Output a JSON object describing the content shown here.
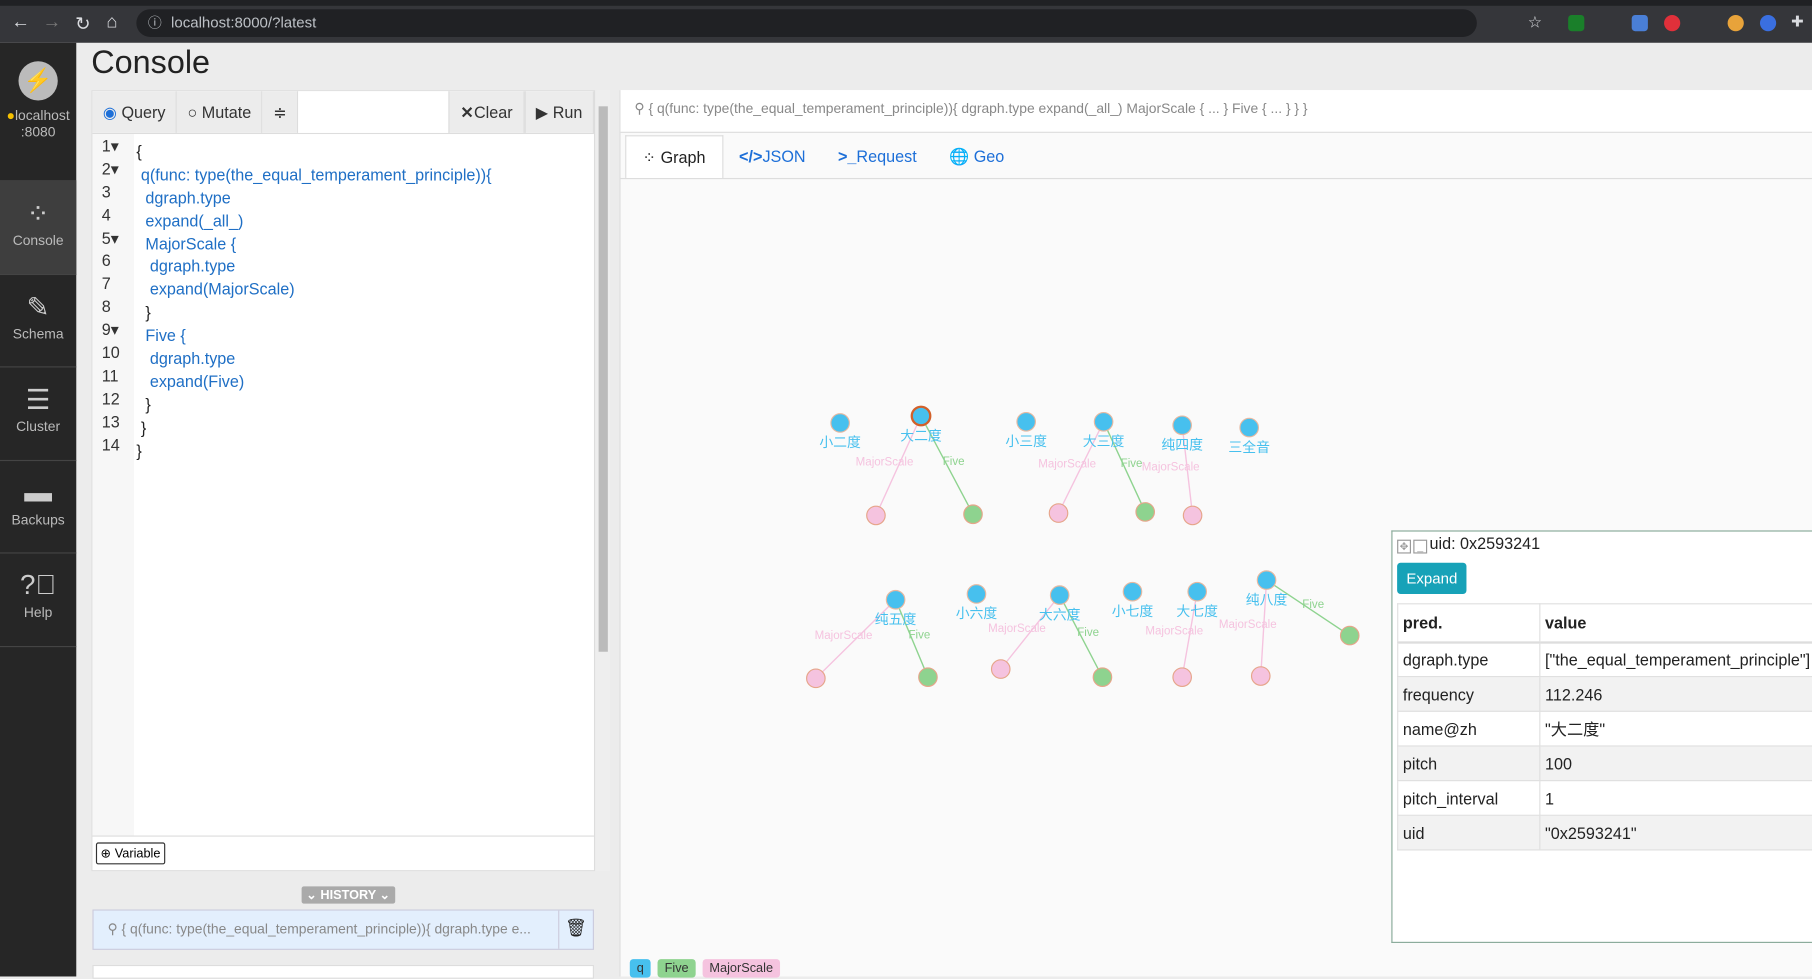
{
  "browser": {
    "url": "localhost:8000/?latest"
  },
  "sidebar": {
    "server": "localhost :8080",
    "items": [
      {
        "label": "Console",
        "icon": "graph-icon"
      },
      {
        "label": "Schema",
        "icon": "tools-icon"
      },
      {
        "label": "Cluster",
        "icon": "layers-icon"
      },
      {
        "label": "Backups",
        "icon": "drive-icon"
      },
      {
        "label": "Help",
        "icon": "help-icon"
      }
    ]
  },
  "page": {
    "title": "Console"
  },
  "editor": {
    "query_label": "Query",
    "mutate_label": "Mutate",
    "clear_label": "Clear",
    "run_label": "Run",
    "mode": "Query",
    "lines": [
      "{",
      " q(func: type(the_equal_temperament_principle)){",
      "  dgraph.type",
      "  expand(_all_)",
      "  MajorScale {",
      "   dgraph.type",
      "   expand(MajorScale)",
      "  }",
      "  Five {",
      "   dgraph.type",
      "   expand(Five)",
      "  }",
      " }",
      "}"
    ],
    "variable_label": "Variable"
  },
  "history": {
    "label": "HISTORY",
    "items": [
      "{ q(func: type(the_equal_temperament_principle)){ dgraph.type e..."
    ]
  },
  "results": {
    "query": "{ q(func: type(the_equal_temperament_principle)){ dgraph.type expand(_all_) MajorScale { ... } Five { ... } } }",
    "tabs": [
      "Graph",
      "JSON",
      "Request",
      "Geo"
    ],
    "active_tab": "Graph"
  },
  "graph": {
    "colors": {
      "q": "#47c0ee",
      "Five": "#8ed38f",
      "MajorScale": "#f5c3df",
      "selected_stroke": "#d2602a"
    },
    "nodes": [
      "小二度",
      "大二度",
      "小三度",
      "大三度",
      "纯四度",
      "三全音",
      "纯五度",
      "小六度",
      "大六度",
      "小七度",
      "大七度",
      "纯八度"
    ],
    "selected": "大二度",
    "edges": [
      {
        "from": "大二度",
        "label": "MajorScale"
      },
      {
        "from": "大二度",
        "label": "Five"
      },
      {
        "from": "大三度",
        "label": "MajorScale"
      },
      {
        "from": "大三度",
        "label": "Five"
      },
      {
        "from": "纯四度",
        "label": "MajorScale"
      },
      {
        "from": "纯五度",
        "label": "MajorScale"
      },
      {
        "from": "纯五度",
        "label": "Five"
      },
      {
        "from": "大六度",
        "label": "MajorScale"
      },
      {
        "from": "大六度",
        "label": "Five"
      },
      {
        "from": "大七度",
        "label": "MajorScale"
      },
      {
        "from": "纯八度",
        "label": "MajorScale"
      },
      {
        "from": "纯八度",
        "label": "Five"
      }
    ]
  },
  "details": {
    "title": "uid: 0x2593241",
    "expand_label": "Expand",
    "headers": [
      "pred.",
      "value"
    ],
    "rows": [
      [
        "dgraph.type",
        "[\"the_equal_temperament_principle\"]"
      ],
      [
        "frequency",
        "112.246"
      ],
      [
        "name@zh",
        "\"大二度\""
      ],
      [
        "pitch",
        "100"
      ],
      [
        "pitch_interval",
        "1"
      ],
      [
        "uid",
        "\"0x2593241\""
      ]
    ]
  },
  "legend": [
    "q",
    "Five",
    "MajorScale"
  ]
}
